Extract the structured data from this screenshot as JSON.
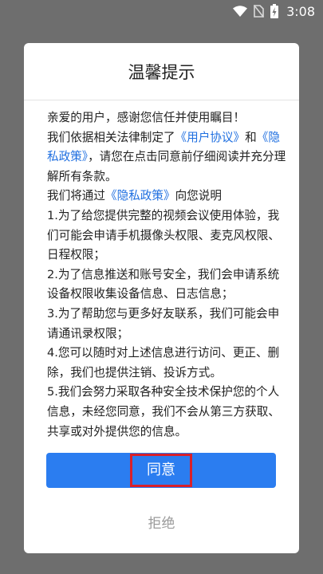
{
  "status_bar": {
    "time": "3:08",
    "icons": [
      "wifi-icon",
      "no-sim-icon",
      "battery-charging-icon"
    ]
  },
  "dialog": {
    "title": "温馨提示",
    "body": [
      {
        "parts": [
          {
            "text": "亲爱的用户，感谢您信任并使用瞩目！"
          }
        ]
      },
      {
        "parts": [
          {
            "text": "我们依据相关法律制定了"
          },
          {
            "text": "《用户协议》",
            "link": true
          },
          {
            "text": "和"
          },
          {
            "text": "《隐私政策》",
            "link": true
          },
          {
            "text": "，请您在点击同意前仔细阅读并充分理解所有条款。"
          }
        ]
      },
      {
        "parts": [
          {
            "text": "我们将通过"
          },
          {
            "text": "《隐私政策》",
            "link": true
          },
          {
            "text": "向您说明"
          }
        ]
      },
      {
        "parts": [
          {
            "text": "1.为了给您提供完整的视频会议使用体验，我们可能会申请手机摄像头权限、麦克风权限、日程权限；"
          }
        ]
      },
      {
        "parts": [
          {
            "text": "2.为了信息推送和账号安全，我们会申请系统设备权限收集设备信息、日志信息；"
          }
        ]
      },
      {
        "parts": [
          {
            "text": "3.为了帮助您与更多好友联系，我们可能会申请通讯录权限；"
          }
        ]
      },
      {
        "parts": [
          {
            "text": "4.您可以随时对上述信息进行访问、更正、删除，我们也提供注销、投诉方式。"
          }
        ]
      },
      {
        "parts": [
          {
            "text": "5.我们会努力采取各种安全技术保护您的个人信息，未经您同意，我们不会从第三方获取、共享或对外提供您的信息。"
          }
        ]
      }
    ],
    "agree_label": "同意",
    "reject_label": "拒绝"
  }
}
